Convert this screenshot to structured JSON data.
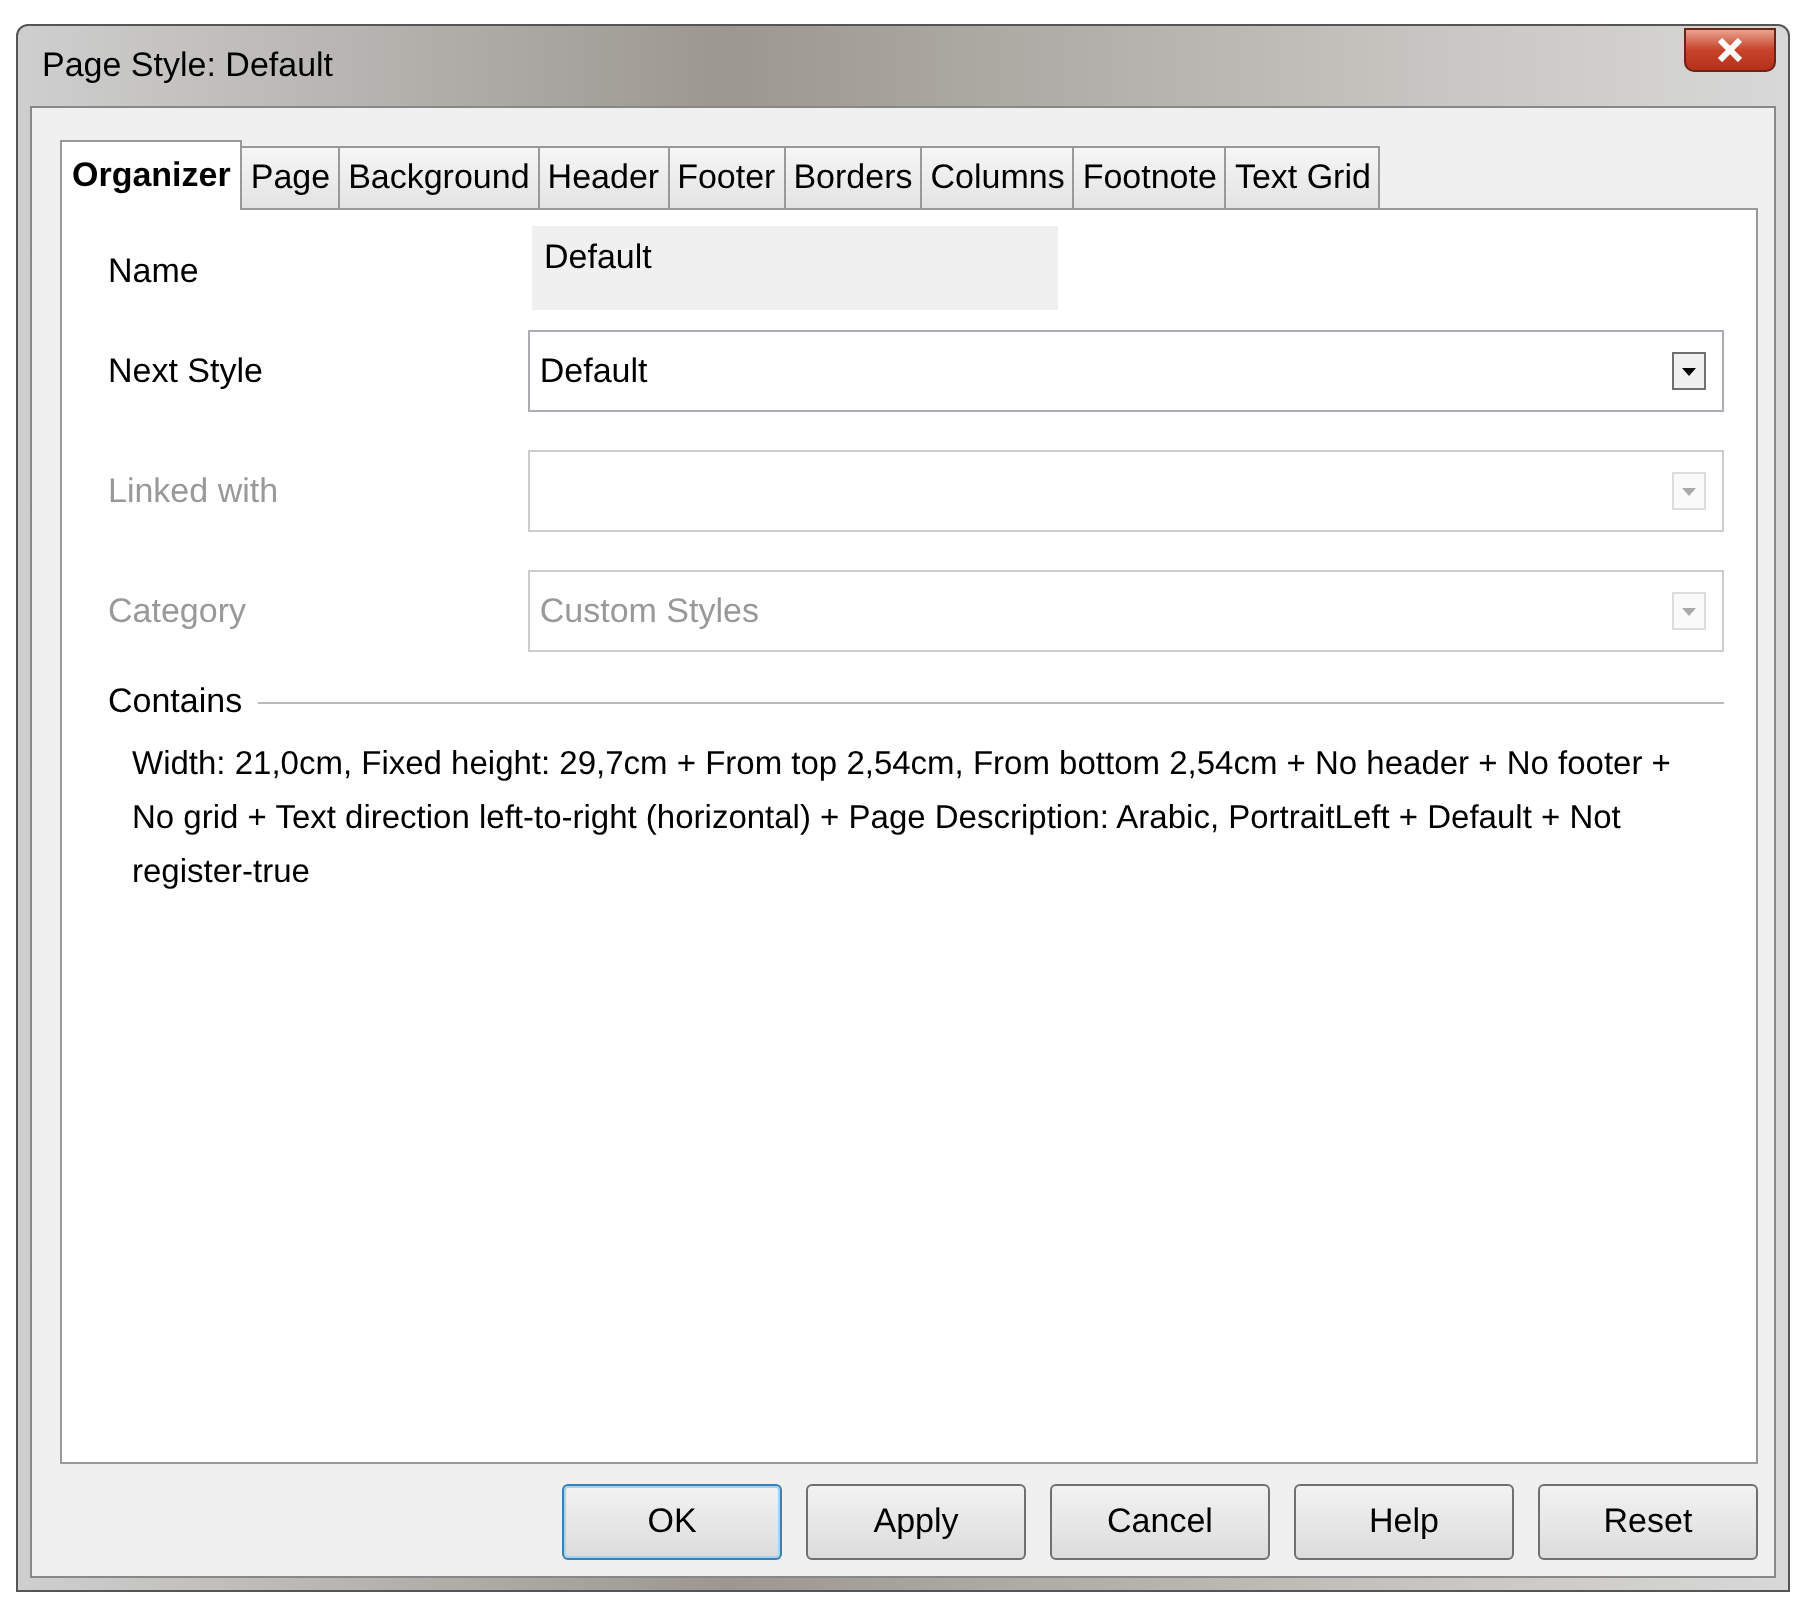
{
  "window": {
    "title": "Page Style: Default"
  },
  "tabs": [
    {
      "label": "Organizer",
      "selected": true
    },
    {
      "label": "Page",
      "selected": false
    },
    {
      "label": "Background",
      "selected": false
    },
    {
      "label": "Header",
      "selected": false
    },
    {
      "label": "Footer",
      "selected": false
    },
    {
      "label": "Borders",
      "selected": false
    },
    {
      "label": "Columns",
      "selected": false
    },
    {
      "label": "Footnote",
      "selected": false
    },
    {
      "label": "Text Grid",
      "selected": false
    }
  ],
  "fields": [
    {
      "label": "Name",
      "kind": "readonly",
      "value": "Default",
      "disabled": false
    },
    {
      "label": "Next Style",
      "kind": "dropdown",
      "value": "Default",
      "disabled": false
    },
    {
      "label": "Linked with",
      "kind": "dropdown",
      "disabled": true
    },
    {
      "label": "Category",
      "kind": "dropdown",
      "value": "Custom Styles",
      "disabled": true
    }
  ],
  "contains": {
    "heading": "Contains",
    "text": "Width: 21,0cm, Fixed height: 29,7cm + From top 2,54cm, From bottom 2,54cm + No header + No footer + No grid + Text direction left-to-right (horizontal) + Page Description: Arabic, PortraitLeft + Default + Not register-true"
  },
  "buttons": [
    {
      "label": "OK",
      "default": true
    },
    {
      "label": "Apply",
      "default": false
    },
    {
      "label": "Cancel",
      "default": false
    },
    {
      "label": "Help",
      "default": false
    },
    {
      "label": "Reset",
      "default": false
    }
  ]
}
